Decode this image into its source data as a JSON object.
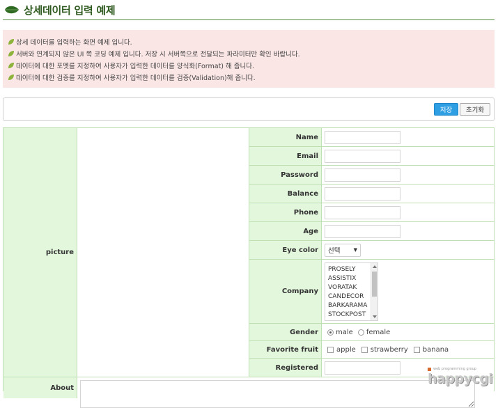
{
  "header": {
    "title": "상세데이터 입력 예제",
    "icon": "leaf-icon"
  },
  "notice": {
    "lines": [
      "상세 데이터를 입력하는 화면 예제 입니다.",
      "서버와 연계되지 않은 UI 쪽 코딩 예제 입니다. 저장 시 서버쪽으로 전달되는 파라미터만 확인 바랍니다.",
      "데이터에 대한 포멧를 지정하여 사용자가 입력한 데이터를 양식화(Format) 해 줍니다.",
      "데이터에 대한 검증를 지정하여 사용자가 입력한 데이터를 검증(Validation)해 줍니다."
    ]
  },
  "toolbar": {
    "save_label": "저장",
    "reset_label": "초기화"
  },
  "form": {
    "picture_label": "picture",
    "fields": {
      "name": {
        "label": "Name",
        "value": ""
      },
      "email": {
        "label": "Email",
        "value": ""
      },
      "password": {
        "label": "Password",
        "value": ""
      },
      "balance": {
        "label": "Balance",
        "value": ""
      },
      "phone": {
        "label": "Phone",
        "value": ""
      },
      "age": {
        "label": "Age",
        "value": ""
      },
      "eye_color": {
        "label": "Eye color",
        "selected": "선택"
      },
      "company": {
        "label": "Company",
        "options": [
          "PROSELY",
          "ASSISTIX",
          "VORATAK",
          "CANDECOR",
          "BARKARAMA",
          "STOCKPOST"
        ]
      },
      "gender": {
        "label": "Gender",
        "options": [
          "male",
          "female"
        ],
        "selected": "male"
      },
      "fruit": {
        "label": "Favorite fruit",
        "options": [
          "apple",
          "strawberry",
          "banana"
        ]
      },
      "registered": {
        "label": "Registered",
        "value": ""
      },
      "about": {
        "label": "About"
      }
    }
  },
  "watermark": {
    "small": "web programming group",
    "main": "happycgi"
  },
  "colors": {
    "accent_green": "#2e5a1f",
    "label_bg": "#e3f7dd",
    "border_green": "#bfe0b3",
    "notice_bg": "#fbe6e6",
    "save_blue": "#2f9fe4"
  }
}
